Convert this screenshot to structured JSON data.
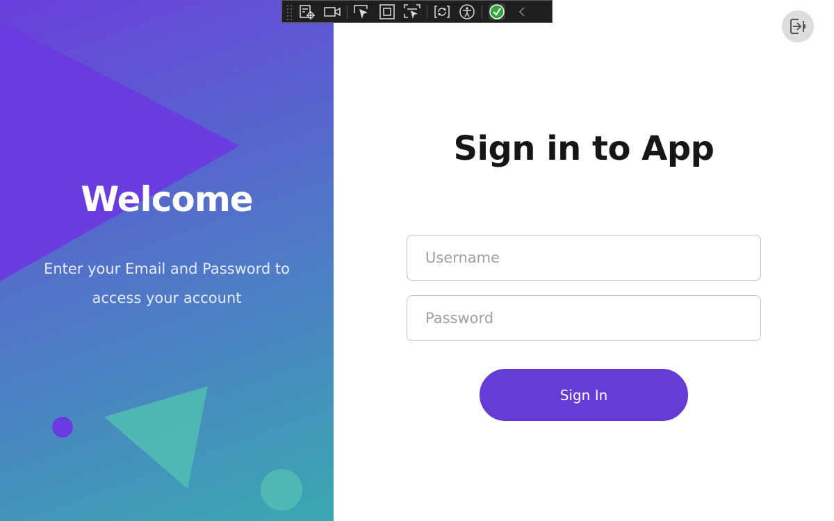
{
  "left_panel": {
    "title": "Welcome",
    "subtitle_line1": "Enter your Email and Password to",
    "subtitle_line2": "access your account",
    "colors": {
      "gradient_top": "#6a3fdc",
      "gradient_bottom": "#3aa8b0",
      "triangle_purple": "#6a3be0",
      "triangle_teal": "#4fb8b4",
      "dot_purple": "#6a3be0",
      "dot_teal": "#4fb8b4"
    }
  },
  "form": {
    "title": "Sign in to App",
    "username_placeholder": "Username",
    "password_placeholder": "Password",
    "signin_label": "Sign In",
    "button_color": "#653cd6"
  },
  "window": {
    "exit_icon": "sign-out-icon"
  },
  "toolbar": {
    "items": [
      "live-visual-tree-icon",
      "camera-icon",
      "select-element-icon",
      "display-layout-adorners-icon",
      "track-focus-icon",
      "hot-reload-icon",
      "accessibility-icon",
      "binding-check-icon",
      "collapse-chevron-icon"
    ]
  }
}
